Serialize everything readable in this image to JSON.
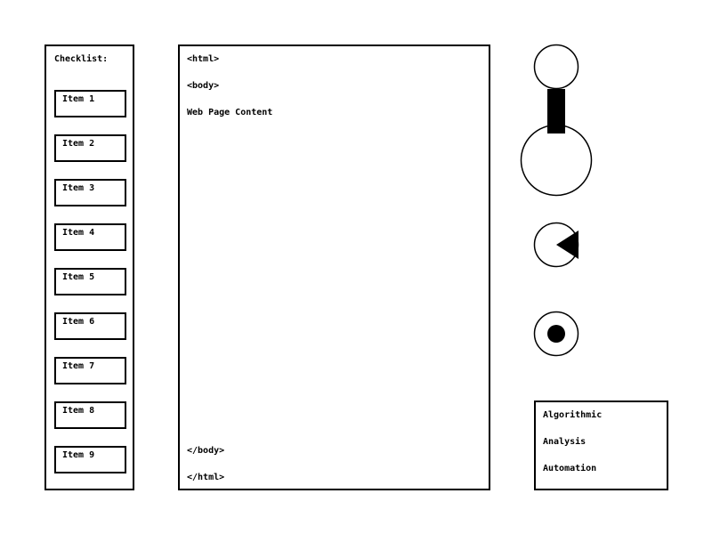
{
  "checklist": {
    "title": "Checklist:",
    "items": [
      "Item 1",
      "Item 2",
      "Item 3",
      "Item 4",
      "Item 5",
      "Item 6",
      "Item 7",
      "Item 8",
      "Item 9"
    ]
  },
  "code": {
    "open_html": "<html>",
    "open_body": "<body>",
    "content": "Web Page Content",
    "close_body": "</body>",
    "close_html": "</html>"
  },
  "keywords": [
    "Algorithmic",
    "Analysis",
    "Automation"
  ],
  "icons": {
    "figure": "stick-figure-icon",
    "pie": "pie-chart-icon",
    "radio": "radio-button-icon"
  },
  "colors": {
    "stroke": "#000000",
    "background": "#ffffff"
  }
}
